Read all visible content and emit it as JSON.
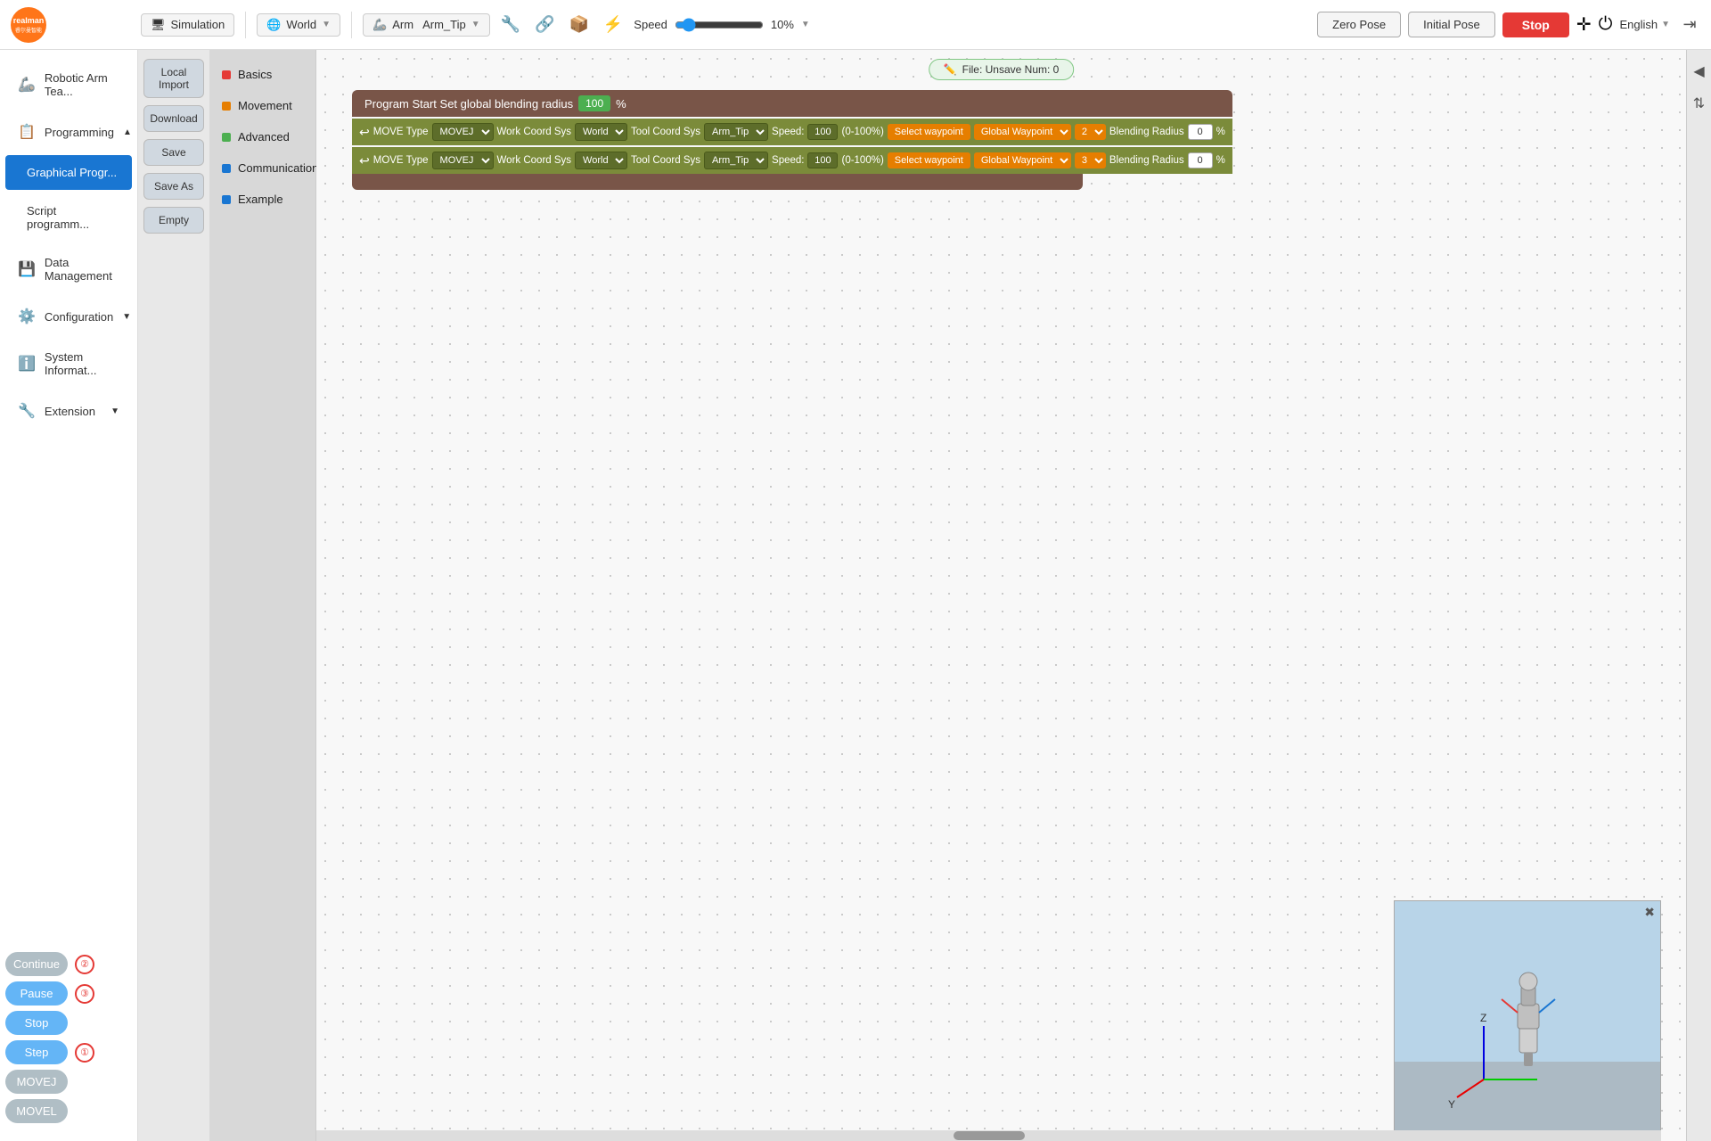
{
  "header": {
    "logo_text": "realman\n睿尔曼智能",
    "mode_label": "Simulation",
    "world_label": "World",
    "arm_tip_label": "Arm_Tip",
    "speed_label": "Speed",
    "speed_value": "10%",
    "zero_pose_label": "Zero Pose",
    "initial_pose_label": "Initial Pose",
    "stop_label": "Stop",
    "lang_label": "English",
    "arm_label": "Arm"
  },
  "sidebar": {
    "items": [
      {
        "id": "robotic-arm",
        "label": "Robotic Arm Tea...",
        "icon": "🦾"
      },
      {
        "id": "programming",
        "label": "Programming",
        "icon": "📋",
        "expanded": true
      },
      {
        "id": "graphical-prog",
        "label": "Graphical Progr...",
        "icon": "",
        "active": true
      },
      {
        "id": "script-prog",
        "label": "Script programm...",
        "icon": ""
      },
      {
        "id": "data-mgmt",
        "label": "Data Management",
        "icon": "💾"
      },
      {
        "id": "configuration",
        "label": "Configuration",
        "icon": "⚙️",
        "expanded": true
      },
      {
        "id": "system-info",
        "label": "System Informat...",
        "icon": "ℹ️"
      },
      {
        "id": "extension",
        "label": "Extension",
        "icon": "🔧",
        "expanded": true
      }
    ]
  },
  "file_ops": {
    "local_import": "Local Import",
    "download": "Download",
    "save": "Save",
    "save_as": "Save As",
    "empty": "Empty"
  },
  "categories": [
    {
      "label": "Basics",
      "color": "#e53935"
    },
    {
      "label": "Movement",
      "color": "#e67e00"
    },
    {
      "label": "Advanced",
      "color": "#4caf50"
    },
    {
      "label": "Communication",
      "color": "#1976d2"
    },
    {
      "label": "Example",
      "color": "#1976d2"
    }
  ],
  "canvas": {
    "file_status": "File:  Unsave  Num: 0"
  },
  "program": {
    "start_label": "Program Start  Set global blending radius",
    "radius_value": "100",
    "radius_unit": "%",
    "move_blocks": [
      {
        "move_type_label": "MOVE Type",
        "move_type_value": "MOVEJ",
        "work_coord_label": "Work Coord Sys",
        "work_coord_value": "World",
        "tool_coord_label": "Tool Coord Sys",
        "tool_coord_value": "Arm_Tip",
        "speed_label": "Speed:",
        "speed_value": "100",
        "speed_range": "(0-100%)",
        "waypoint_label": "Select waypoint",
        "global_label": "Global Waypoint",
        "wp_num": "2",
        "blend_label": "Blending Radius",
        "blend_value": "0",
        "blend_unit": "%"
      },
      {
        "move_type_label": "MOVE Type",
        "move_type_value": "MOVEJ",
        "work_coord_label": "Work Coord Sys",
        "work_coord_value": "World",
        "tool_coord_label": "Tool Coord Sys",
        "tool_coord_value": "Arm_Tip",
        "speed_label": "Speed:",
        "speed_value": "100",
        "speed_range": "(0-100%)",
        "waypoint_label": "Select waypoint",
        "global_label": "Global Waypoint",
        "wp_num": "3",
        "blend_label": "Blending Radius",
        "blend_value": "0",
        "blend_unit": "%"
      }
    ]
  },
  "controls": {
    "continue_label": "Continue",
    "pause_label": "Pause",
    "stop_label": "Stop",
    "step_label": "Step",
    "movej_label": "MOVEJ",
    "movel_label": "MOVEL",
    "circle_nums": [
      "②",
      "③",
      "①"
    ]
  },
  "viewport": {
    "axis_z": "Z",
    "axis_y": "Y"
  }
}
